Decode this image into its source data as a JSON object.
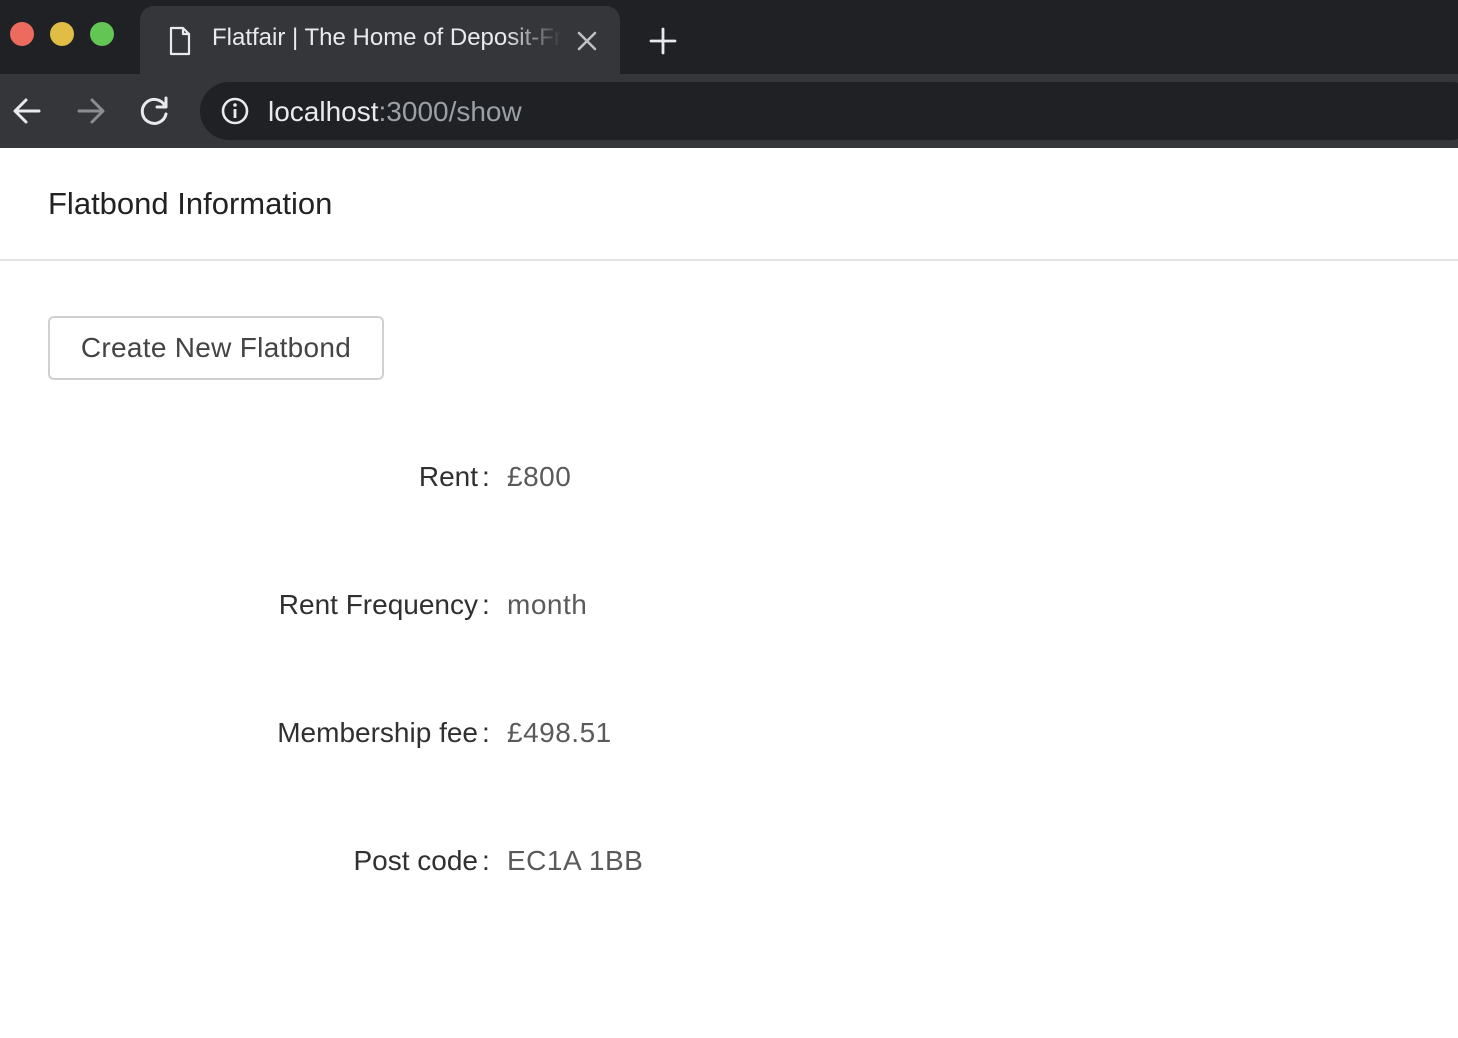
{
  "browser": {
    "tab": {
      "title": "Flatfair | The Home of Deposit-Free Renting",
      "icon": "document-icon"
    },
    "url": {
      "host": "localhost",
      "path": ":3000/show"
    },
    "colors": {
      "tabbar_bg": "#202124",
      "toolbar_bg": "#35363a",
      "close": "#ed6a5e",
      "minimize": "#e0be45",
      "maximize": "#62c554"
    }
  },
  "page": {
    "title": "Flatbond Information",
    "create_button_label": "Create New Flatbond",
    "separator": ":",
    "fields": [
      {
        "label": "Rent",
        "value": "£800"
      },
      {
        "label": "Rent Frequency",
        "value": "month"
      },
      {
        "label": "Membership fee",
        "value": "£498.51"
      },
      {
        "label": "Post code",
        "value": "EC1A 1BB"
      }
    ]
  }
}
